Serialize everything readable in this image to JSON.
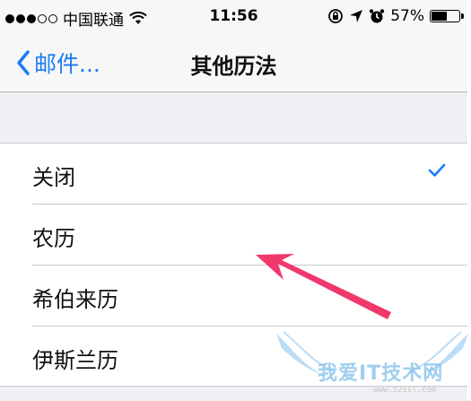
{
  "status_bar": {
    "carrier": "中国联通",
    "time": "11:56",
    "battery_percent": "57%",
    "battery_level": 0.57,
    "signal_bars_filled": 3,
    "signal_bars_total": 5
  },
  "nav": {
    "back_label": "邮件...",
    "title": "其他历法"
  },
  "calendars": [
    {
      "label": "关闭",
      "selected": true
    },
    {
      "label": "农历",
      "selected": false
    },
    {
      "label": "希伯来历",
      "selected": false
    },
    {
      "label": "伊斯兰历",
      "selected": false
    }
  ],
  "colors": {
    "accent": "#1a7cf5",
    "annotation_arrow": "#f0386b"
  },
  "watermark": {
    "text": "我爱IT技术网",
    "url": "www.52ssl.com"
  }
}
